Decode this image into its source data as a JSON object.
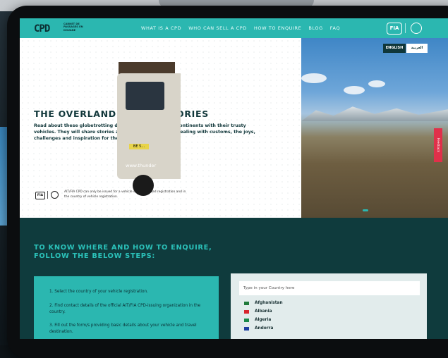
{
  "nav": {
    "logo": "CPD",
    "logo_subtitle": "CARNET DE PASSAGES EN DOUANE",
    "links": [
      "WHAT IS A CPD",
      "WHO CAN SELL A CPD",
      "HOW TO ENQUIRE",
      "BLOG",
      "FAQ"
    ],
    "fia": "FIA"
  },
  "hero": {
    "title": "THE OVERLANDER: CPD STORIES",
    "description": "Read about these globetrotting daredevils who traverse continents with their trusty vehicles. They will share stories about border crossings, dealing with customs, the joys, challenges and inspiration for their adventure.",
    "note": "AIT/FIA CPD can only be issued for a vehicle with valid road registration and in the country of vehicle registration.",
    "fia": "FIA"
  },
  "language": {
    "english": "ENGLISH",
    "arabic": "العربية"
  },
  "photo": {
    "plate": "BE 5...",
    "van_text": "www.thunder"
  },
  "feedback": "Feedback",
  "enquire": {
    "title": "TO KNOW WHERE AND HOW TO ENQUIRE, FOLLOW THE BELOW STEPS:",
    "steps": [
      "1. Select the country of your vehicle registration.",
      "2. Find contact details of the official AIT/FIA CPD-issuing organization in the country.",
      "3. Fill out the form/s providing basic details about your vehicle and travel destination."
    ]
  },
  "country_search": {
    "placeholder": "Type in your Country here",
    "countries": [
      {
        "name": "Afghanistan",
        "flag": "#1f7a3a"
      },
      {
        "name": "Albania",
        "flag": "#d8262e"
      },
      {
        "name": "Algeria",
        "flag": "#1a8a4a"
      },
      {
        "name": "Andorra",
        "flag": "#1f3fa0"
      }
    ]
  }
}
